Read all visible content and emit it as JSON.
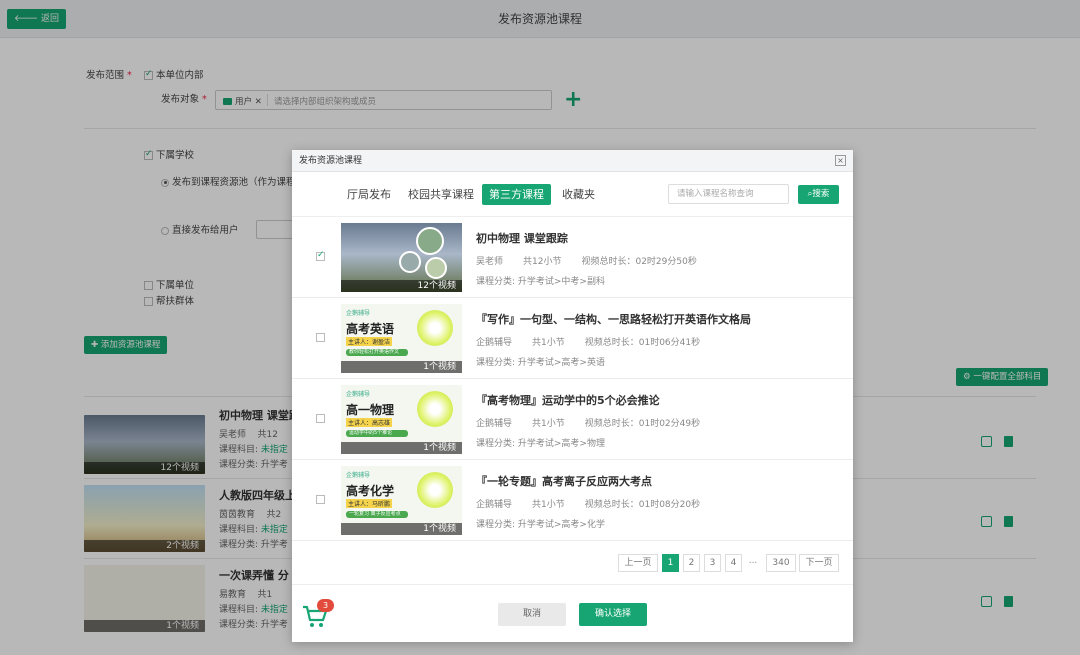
{
  "header": {
    "back_label": "返回",
    "title": "发布资源池课程"
  },
  "form": {
    "scope_label": "发布范围",
    "own_unit_label": "本单位内部",
    "target_label": "发布对象",
    "target_tag": "用户",
    "target_placeholder": "请选择内部组织架构或成员",
    "sub_school_label": "下属学校",
    "publish_pool_label": "发布到课程资源池（作为课程",
    "direct_user_label": "直接发布给用户",
    "sub_unit_label": "下属单位",
    "help_group_label": "帮扶群体",
    "add_pool_btn": "添加资源池课程",
    "config_all_btn": "一键配置全部科目"
  },
  "bg_list": [
    {
      "title": "初中物理 课堂跟",
      "teacher": "吴老师",
      "count": "共12",
      "subject_label": "课程科目:",
      "subject_val": "未指定",
      "category": "课程分类: 升学考",
      "videos": "12个视频"
    },
    {
      "title": "人教版四年级上",
      "teacher": "茵茵教育",
      "count": "共2",
      "subject_label": "课程科目:",
      "subject_val": "未指定",
      "category": "课程分类: 升学考",
      "videos": "2个视频"
    },
    {
      "title": "一次课弄懂 分",
      "teacher": "易教育",
      "count": "共1",
      "subject_label": "课程科目:",
      "subject_val": "未指定",
      "category": "课程分类: 升学考",
      "videos": "1个视频"
    }
  ],
  "modal": {
    "title": "发布资源池课程",
    "close": "×",
    "tabs": [
      "厅局发布",
      "校园共享课程",
      "第三方课程",
      "收藏夹"
    ],
    "active_tab": 2,
    "search_placeholder": "请输入课程名称查询",
    "search_btn": "搜索",
    "courses": [
      {
        "title": "初中物理 课堂跟踪",
        "author": "吴老师",
        "sections": "共12小节",
        "duration": "视频总时长：02时29分50秒",
        "category": "课程分类: 升学考试>中考>副科",
        "videos": "12个视频",
        "checked": true,
        "thumb": "photo"
      },
      {
        "title": "『写作』一句型、一结构、一思路轻松打开英语作文格局",
        "author": "企鹅辅导",
        "sections": "共1小节",
        "duration": "视频总时长：01时06分41秒",
        "category": "课程分类: 升学考试>高考>英语",
        "videos": "1个视频",
        "checked": false,
        "thumb": "card",
        "card_big": "高考英语",
        "card_sub": "主讲人：谢盈洁",
        "card_bar": "教你轻松打开英语作文"
      },
      {
        "title": "『高考物理』运动学中的5个必会推论",
        "author": "企鹅辅导",
        "sections": "共1小节",
        "duration": "视频总时长：01时02分49秒",
        "category": "课程分类: 升学考试>高考>物理",
        "videos": "1个视频",
        "checked": false,
        "thumb": "card",
        "card_big": "高一物理",
        "card_sub": "主讲人：高志雄",
        "card_bar": "运动学中的5个推论"
      },
      {
        "title": "『一轮专题』高考离子反应两大考点",
        "author": "企鹅辅导",
        "sections": "共1小节",
        "duration": "视频总时长：01时08分20秒",
        "category": "课程分类: 升学考试>高考>化学",
        "videos": "1个视频",
        "checked": false,
        "thumb": "card",
        "card_big": "高考化学",
        "card_sub": "主讲人：马昕鹏",
        "card_bar": "一轮复习 离子反应考点"
      }
    ],
    "card_logo": "企鹅辅导",
    "pager": {
      "prev": "上一页",
      "pages": [
        "1",
        "2",
        "3",
        "4"
      ],
      "ellipsis": "...",
      "last": "340",
      "next": "下一页",
      "current": "1"
    },
    "cancel": "取消",
    "confirm": "确认选择",
    "cart_count": "3"
  }
}
